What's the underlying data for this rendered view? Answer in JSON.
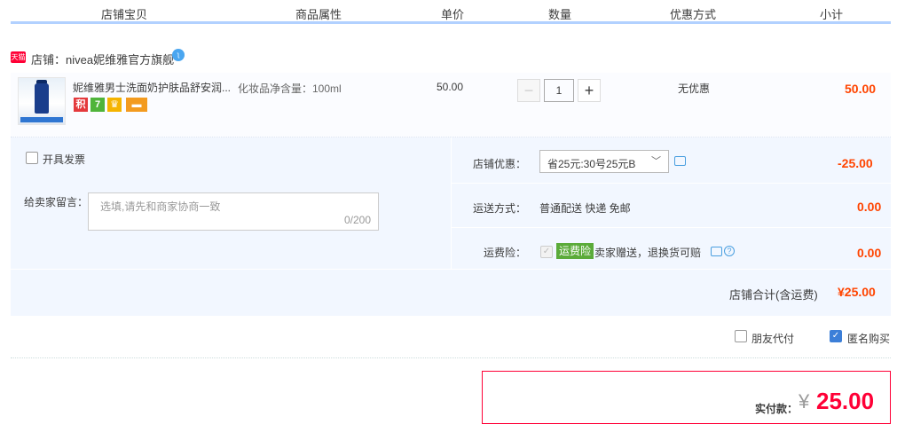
{
  "header": {
    "columns": [
      "店铺宝贝",
      "商品属性",
      "单价",
      "数量",
      "优惠方式",
      "小计"
    ]
  },
  "shop": {
    "platform_badge": "天猫",
    "name": "店铺：nivea妮维雅官方旗舰",
    "chat_icon": "wangwang-icon"
  },
  "item": {
    "title": "妮维雅男士洗面奶护肤品舒安润...",
    "attribute": "化妆品净含量：100ml",
    "unit_price": "50.00",
    "badges": [
      {
        "text": "积",
        "color": "#e4393c"
      },
      {
        "text": "7",
        "color": "#4fb43a"
      },
      {
        "text": "♛",
        "color": "#f5b400"
      },
      {
        "text": "▬",
        "color": "#f39b1f"
      }
    ],
    "quantity": "1",
    "minus": "−",
    "plus": "+",
    "discount_method": "无优惠",
    "subtotal": "50.00"
  },
  "invoice": {
    "label": "开具发票",
    "checked": false
  },
  "message": {
    "label": "给卖家留言：",
    "placeholder": "选填,请先和商家协商一致",
    "counter": "0/200"
  },
  "store_discount": {
    "label": "店铺优惠：",
    "selected": "省25元:30号25元B",
    "amount": "-25.00"
  },
  "shipping": {
    "label": "运送方式：",
    "value": "普通配送 快递 免邮",
    "amount": "0.00"
  },
  "insurance": {
    "label": "运费险：",
    "badge": "运费险",
    "text": "卖家赠送，退换货可赔",
    "amount": "0.00"
  },
  "store_total": {
    "label": "店铺合计(含运费)",
    "amount": "¥25.00"
  },
  "options": {
    "friend_pay": "朋友代付",
    "friend_pay_checked": false,
    "anonymous": "匿名购买",
    "anonymous_checked": true
  },
  "payment": {
    "label": "实付款：",
    "currency": "¥",
    "amount": "25.00"
  },
  "colors": {
    "accent_red": "#ff4400",
    "header_line": "#b2d1ff",
    "section_bg": "#f2f7ff",
    "checkbox_blue": "#3c7fd8"
  }
}
